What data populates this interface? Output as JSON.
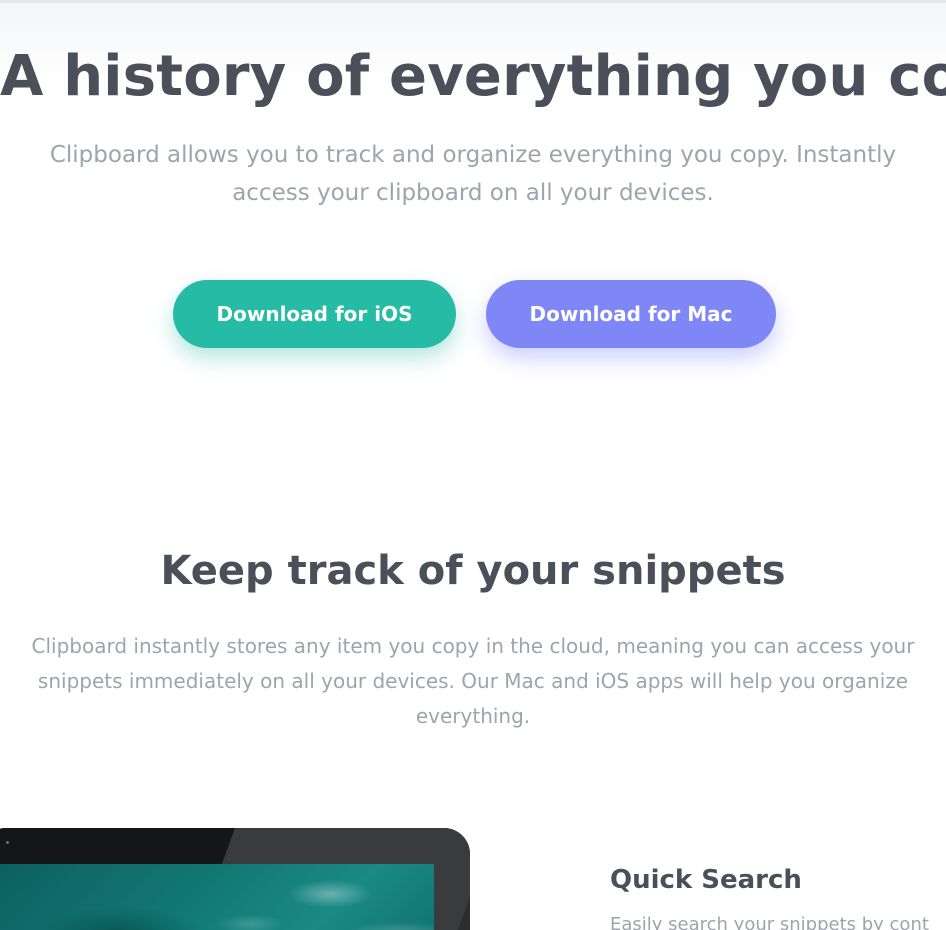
{
  "hero": {
    "title": "A history of everything you copy",
    "subtitle": "Clipboard allows you to track and organize everything you copy. Instantly access your clipboard on all your devices."
  },
  "buttons": {
    "ios_label": "Download for iOS",
    "mac_label": "Download for Mac"
  },
  "snippets": {
    "title": "Keep track of your snippets",
    "text": "Clipboard instantly stores any item you copy in the cloud, meaning you can access your snippets immediately on all your devices. Our Mac and iOS apps will help you organize everything."
  },
  "feature": {
    "title": "Quick Search",
    "text": "Easily search your snippets by cont"
  },
  "colors": {
    "heading": "#4a4f59",
    "body_text": "#9ea4ad",
    "ios_button": "#26bba4",
    "mac_button": "#7f87f7"
  }
}
